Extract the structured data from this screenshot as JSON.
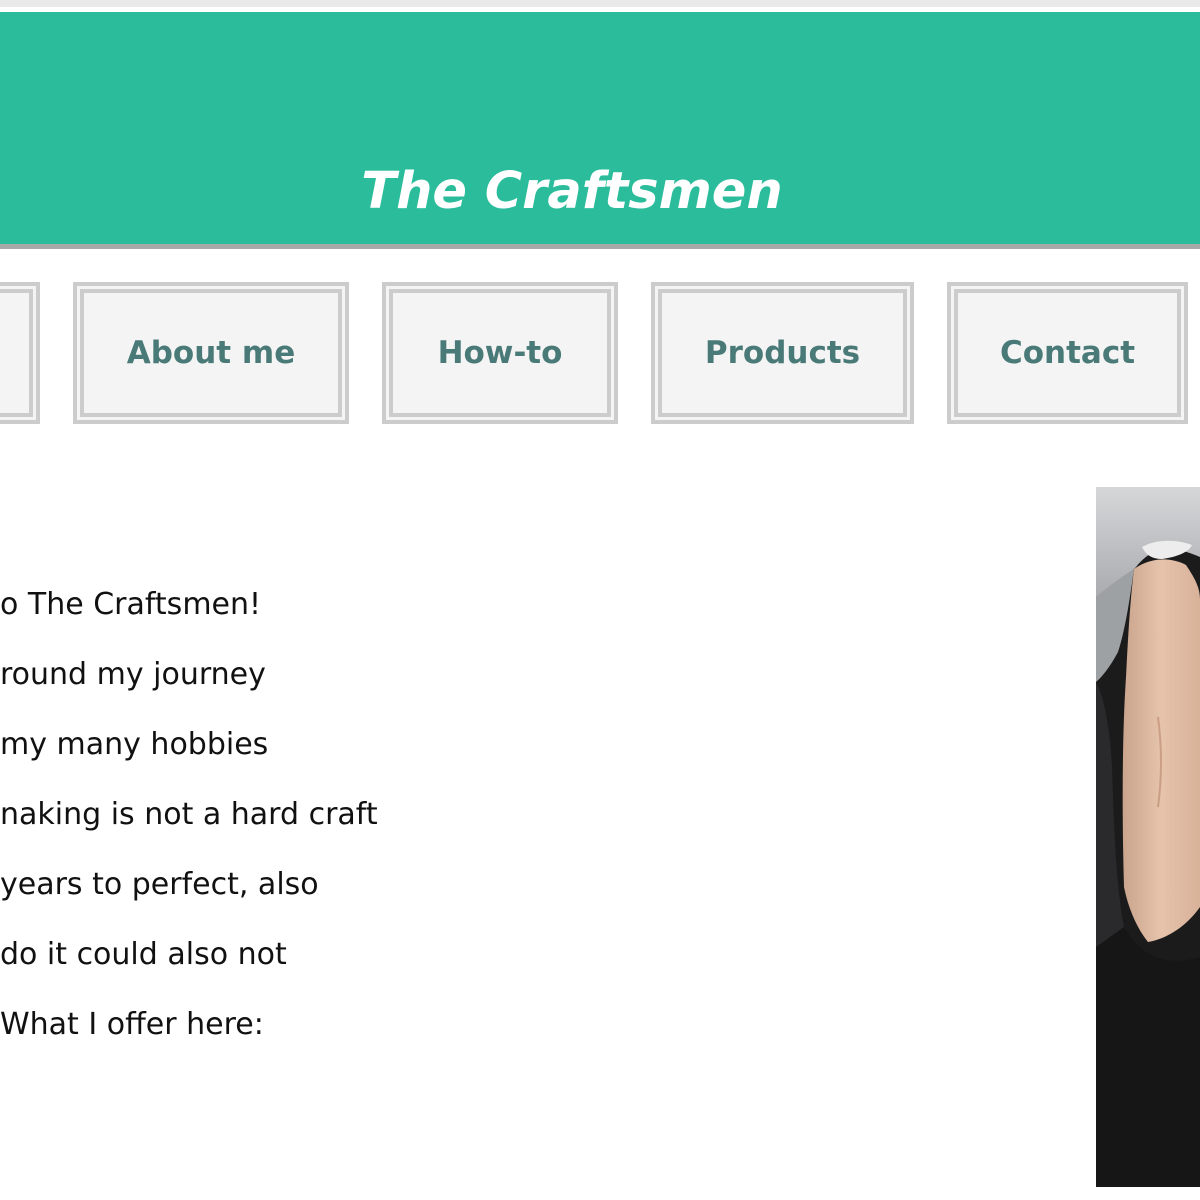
{
  "header": {
    "title": "The Craftsmen"
  },
  "nav": {
    "items": [
      {
        "label": ""
      },
      {
        "label": "About me"
      },
      {
        "label": "How-to"
      },
      {
        "label": "Products"
      },
      {
        "label": "Contact"
      }
    ]
  },
  "intro": {
    "lines": [
      "o The Craftsmen!",
      "round my journey",
      "my many hobbies",
      "naking is not a hard craft",
      "years to perfect, also",
      "do it could also not",
      "What I offer here:"
    ]
  },
  "colors": {
    "banner": "#2bbd9b",
    "nav_text": "#4a7a78",
    "nav_border": "#cccccc",
    "nav_background": "#f4f4f4"
  },
  "photo": {
    "description_icon": "person-photo"
  }
}
